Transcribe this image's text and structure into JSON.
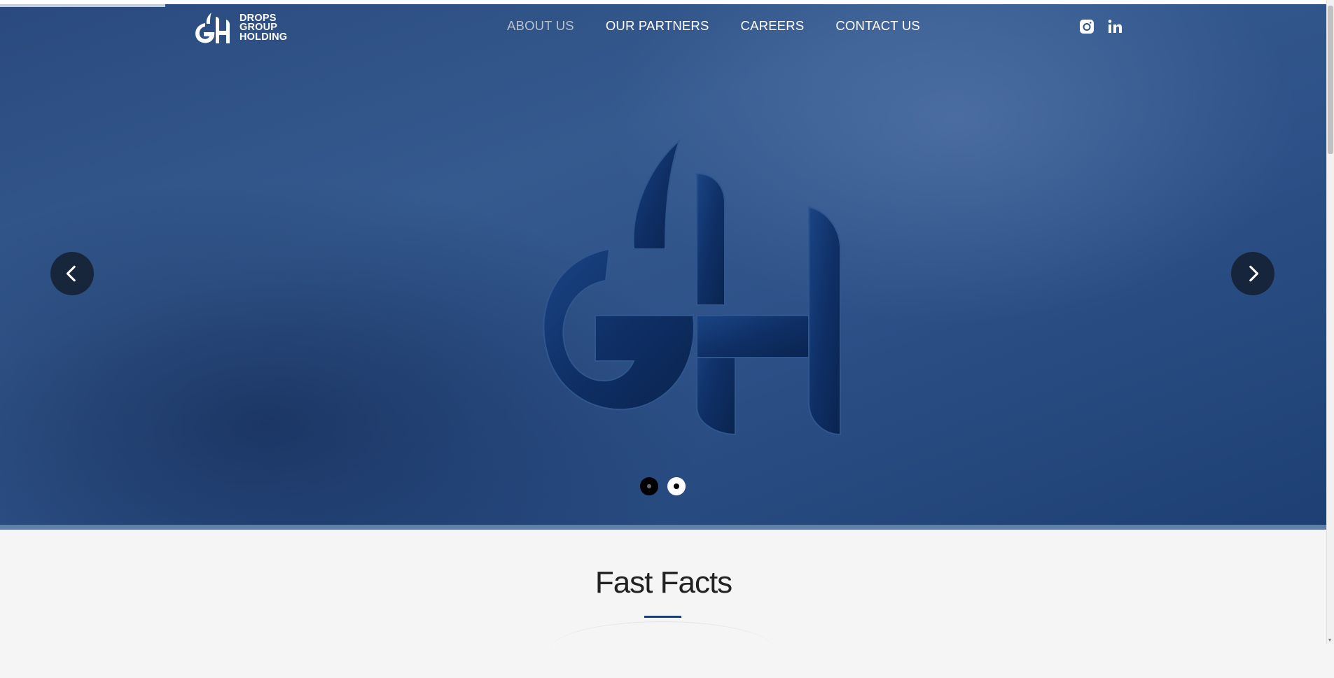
{
  "logo": {
    "line1": "DROPS",
    "line2": "GROUP",
    "line3": "HOLDING"
  },
  "nav": {
    "items": [
      {
        "label": "ABOUT US",
        "active": true
      },
      {
        "label": "OUR PARTNERS",
        "active": false
      },
      {
        "label": "CAREERS",
        "active": false
      },
      {
        "label": "CONTACT US",
        "active": false
      }
    ]
  },
  "social": {
    "icons": [
      "instagram-icon",
      "linkedin-icon"
    ]
  },
  "hero": {
    "carousel": {
      "slides": 2,
      "active_slide": 2
    },
    "colors": {
      "background": "#2d5188",
      "letters": "#0f2e63"
    }
  },
  "facts": {
    "title": "Fast Facts",
    "accent": "#1c3f7a"
  }
}
